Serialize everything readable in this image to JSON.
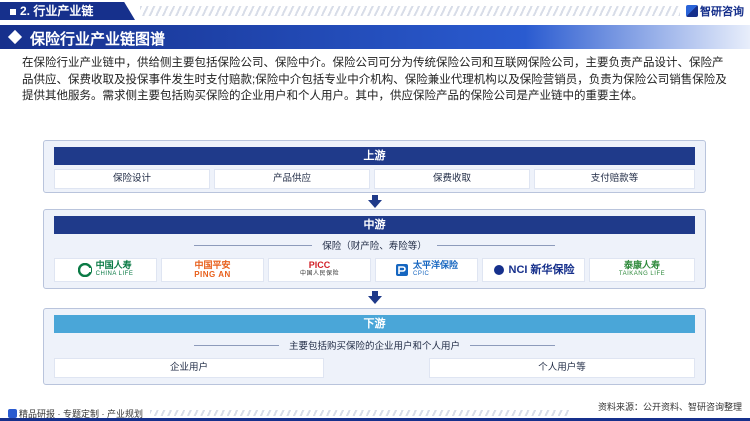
{
  "header": {
    "section_tag": "2. 行业产业链",
    "brand": "智研咨询"
  },
  "title": "保险行业产业链图谱",
  "intro": "在保险行业产业链中，供给侧主要包括保险公司、保险中介。保险公司可分为传统保险公司和互联网保险公司，主要负责产品设计、保险产品供应、保费收取及投保事件发生时支付赔款;保险中介包括专业中介机构、保险兼业代理机构以及保险营销员，负责为保险公司销售保险及提供其他服务。需求侧主要包括购买保险的企业用户和个人用户。其中，供应保险产品的保险公司是产业链中的重要主体。",
  "upstream": {
    "label": "上游",
    "items": [
      "保险设计",
      "产品供应",
      "保费收取",
      "支付赔款等"
    ]
  },
  "midstream": {
    "label": "中游",
    "subtitle": "保险（财产险、寿险等）",
    "logos": [
      {
        "name": "中国人寿",
        "sub": "CHINA LIFE",
        "color": "#0a7a45",
        "icon": "china-life-icon"
      },
      {
        "name": "中国平安",
        "sub": "PING AN",
        "color": "#e8601c",
        "icon": "ping-an-icon"
      },
      {
        "name": "PICC",
        "sub": "中国人民保险",
        "color": "#d11f26",
        "icon": "picc-icon"
      },
      {
        "name": "太平洋保险",
        "sub": "CPIC",
        "color": "#1666c0",
        "icon": "cpic-icon"
      },
      {
        "name": "NCI 新华保险",
        "sub": "",
        "color": "#16308c",
        "icon": "nci-icon"
      },
      {
        "name": "泰康人寿",
        "sub": "TAIKANG LIFE",
        "color": "#2f8a3c",
        "icon": "taikang-icon"
      }
    ]
  },
  "downstream": {
    "label": "下游",
    "subtitle": "主要包括购买保险的企业用户和个人用户",
    "items": [
      "企业用户",
      "个人用户等"
    ]
  },
  "footer": {
    "left": "精品研报 · 专题定制 · 产业规划",
    "right": "资料来源：公开资料、智研咨询整理"
  }
}
